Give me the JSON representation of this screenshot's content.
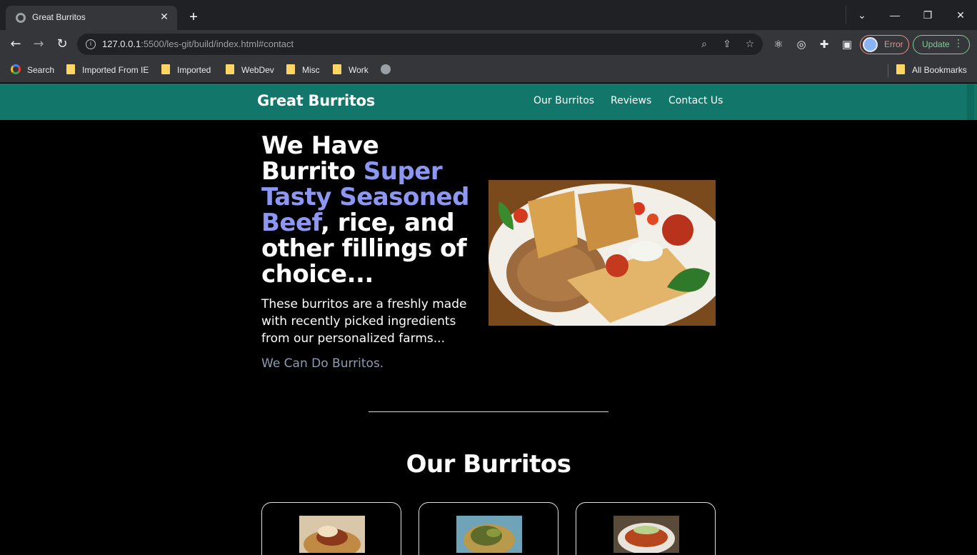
{
  "browser": {
    "tab_title": "Great Burritos",
    "url_host": "127.0.0.1",
    "url_rest": ":5500/les-git/build/index.html#contact",
    "profile_status": "Error",
    "update_label": "Update",
    "bookmarks": [
      "Search",
      "Imported From IE",
      "Imported",
      "WebDev",
      "Misc",
      "Work"
    ],
    "all_bookmarks": "All Bookmarks"
  },
  "nav": {
    "brand": "Great Burritos",
    "links": [
      "Our Burritos",
      "Reviews",
      "Contact Us"
    ]
  },
  "hero": {
    "title_line": "We Have Burrito",
    "title_accent": "Super Tasty Seasoned Beef",
    "title_rest": ", rice, and other fillings of choice...",
    "body": "These burritos are a freshly made with recently picked ingredients from our personalized farms...",
    "tagline": "We Can Do Burritos."
  },
  "section": {
    "title": "Our Burritos"
  },
  "colors": {
    "navbar": "#12776a",
    "accent": "#8d97f2",
    "tagline": "#8c9bb4"
  }
}
